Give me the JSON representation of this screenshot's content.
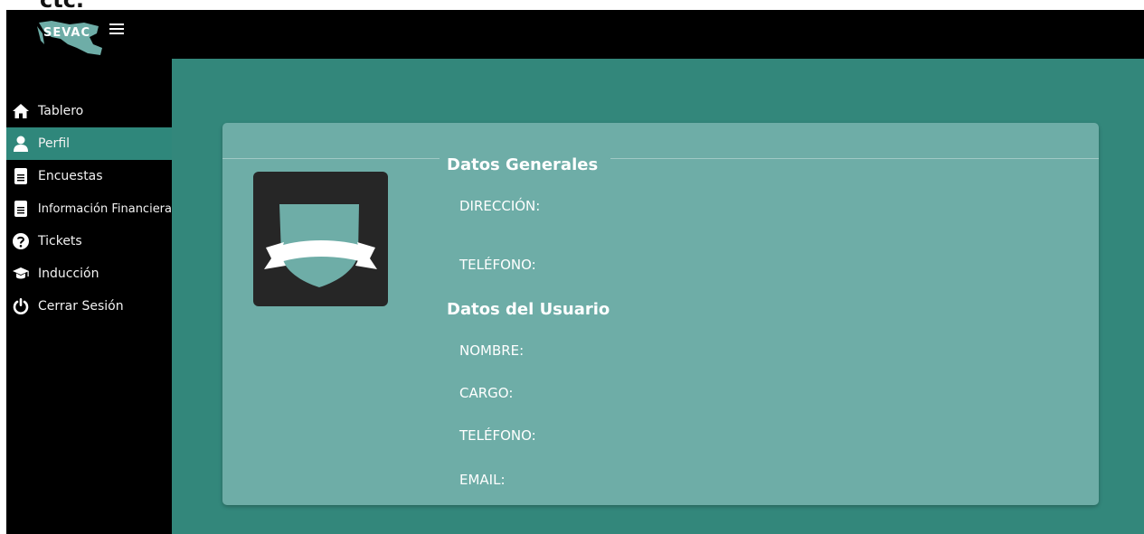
{
  "top_fragment": "ctc.",
  "brand": {
    "logo_text": "SEVAC"
  },
  "sidebar": {
    "items": [
      {
        "label": "Tablero",
        "icon": "home-icon",
        "active": false
      },
      {
        "label": "Perfil",
        "icon": "user-icon",
        "active": true
      },
      {
        "label": "Encuestas",
        "icon": "document-icon",
        "active": false
      },
      {
        "label": "Información Financiera",
        "icon": "document-icon",
        "active": false
      },
      {
        "label": "Tickets",
        "icon": "help-circle-icon",
        "active": false
      },
      {
        "label": "Inducción",
        "icon": "graduation-cap-icon",
        "active": false
      },
      {
        "label": "Cerrar Sesión",
        "icon": "power-icon",
        "active": false
      }
    ]
  },
  "profile": {
    "general": {
      "title": "Datos Generales",
      "direccion_label": "DIRECCIÓN:",
      "telefono_label": "TELÉFONO:"
    },
    "user": {
      "title": "Datos del Usuario",
      "nombre_label": "NOMBRE:",
      "cargo_label": "CARGO:",
      "telefono_label": "TELÉFONO:",
      "email_label": "EMAIL:"
    }
  },
  "colors": {
    "sidebar_bg": "#000000",
    "active_item": "#2f877b",
    "main_bg": "#33877b",
    "card_bg": "#6eada7",
    "badge_bg": "#262626",
    "shield": "#6eada7",
    "ribbon": "#ffffff"
  }
}
